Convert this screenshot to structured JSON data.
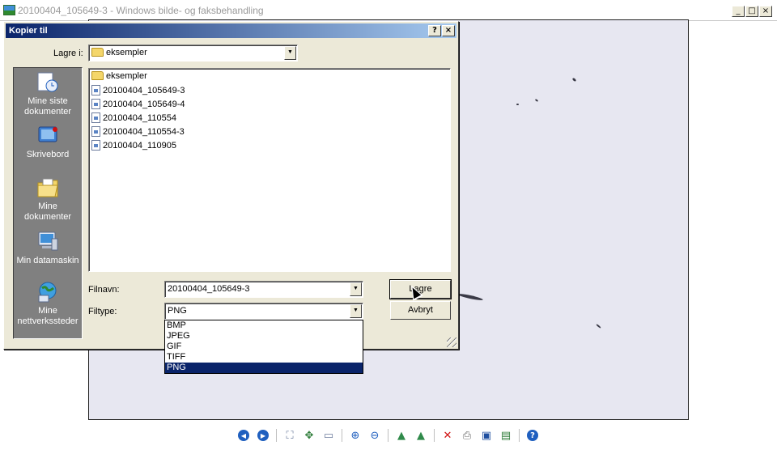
{
  "app": {
    "title": "20100404_105649-3 - Windows bilde- og faksbehandling",
    "window_buttons": [
      "_",
      "□",
      "×"
    ]
  },
  "dialog": {
    "title": "Kopier til",
    "help_btn": "?",
    "close_btn": "×",
    "save_in_label": "Lagre i:",
    "save_in_value": "eksempler",
    "places": [
      {
        "label": "Mine siste dokumenter",
        "icon": "recent-documents-icon"
      },
      {
        "label": "Skrivebord",
        "icon": "desktop-icon"
      },
      {
        "label": "Mine dokumenter",
        "icon": "my-documents-icon"
      },
      {
        "label": "Min datamaskin",
        "icon": "my-computer-icon"
      },
      {
        "label": "Mine nettverkssteder",
        "icon": "network-places-icon"
      }
    ],
    "files": [
      {
        "name": "eksempler",
        "type": "folder"
      },
      {
        "name": "20100404_105649-3",
        "type": "image"
      },
      {
        "name": "20100404_105649-4",
        "type": "image"
      },
      {
        "name": "20100404_110554",
        "type": "image"
      },
      {
        "name": "20100404_110554-3",
        "type": "image"
      },
      {
        "name": "20100404_110905",
        "type": "image"
      }
    ],
    "filename_label": "Filnavn:",
    "filename_value": "20100404_105649-3",
    "filetype_label": "Filtype:",
    "filetype_value": "PNG",
    "filetype_options": [
      "BMP",
      "JPEG",
      "GIF",
      "TIFF",
      "PNG"
    ],
    "filetype_selected": "PNG",
    "save_button": "Lagre",
    "cancel_button": "Avbryt"
  },
  "colors": {
    "dialog_title_start": "#0a246a",
    "dialog_title_end": "#a6caf0",
    "selection": "#0a246a",
    "dialog_face": "#ece9d8",
    "photo_sky": "#e7e7f1"
  },
  "toolbar_icons": [
    "previous-image-icon",
    "next-image-icon",
    "best-fit-icon",
    "actual-size-icon",
    "slideshow-icon",
    "zoom-in-icon",
    "zoom-out-icon",
    "rotate-clockwise-icon",
    "rotate-counterclockwise-icon",
    "delete-icon",
    "print-icon",
    "copy-to-icon",
    "open-for-editing-icon",
    "help-icon"
  ]
}
